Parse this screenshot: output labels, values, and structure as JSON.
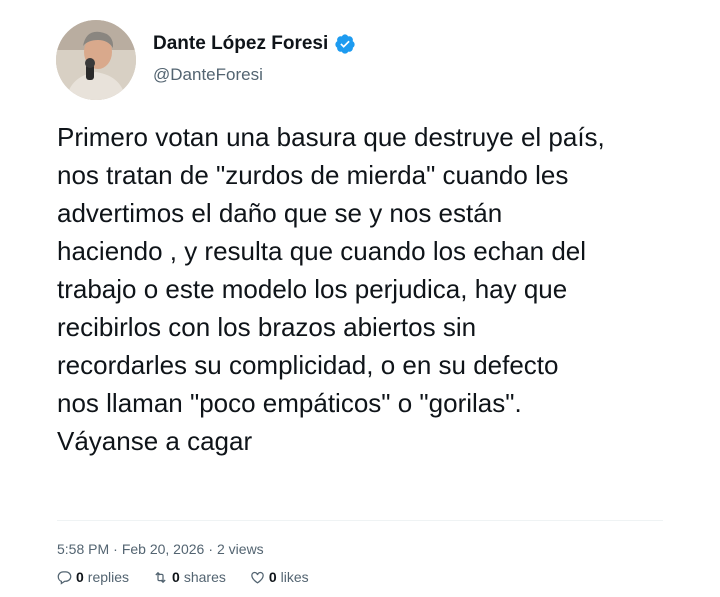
{
  "author": {
    "display_name": "Dante López Foresi",
    "handle": "@DanteForesi",
    "verified_color": "#1d9bf0"
  },
  "tweet": {
    "text": "Primero votan una basura que destruye el país,\nnos tratan de \"zurdos de mierda\" cuando les\nadvertimos el daño que se y nos están\nhaciendo , y resulta que cuando los echan del\ntrabajo o este modelo los perjudica, hay que\nrecibirlos con los brazos abiertos sin\nrecordarles su complicidad, o en su defecto\nnos llaman \"poco empáticos\" o \"gorilas\".\nVáyanse a cagar",
    "time": "5:58 PM",
    "date": "Feb 20, 2026",
    "views": "2 views",
    "separator": "·"
  },
  "actions": {
    "replies_count": "0",
    "replies_label": "replies",
    "shares_count": "0",
    "shares_label": "shares",
    "likes_count": "0",
    "likes_label": "likes"
  },
  "icons": {
    "reply": "reply-bubble-icon",
    "share": "retweet-icon",
    "like": "heart-icon",
    "verified": "verified-badge-icon"
  }
}
